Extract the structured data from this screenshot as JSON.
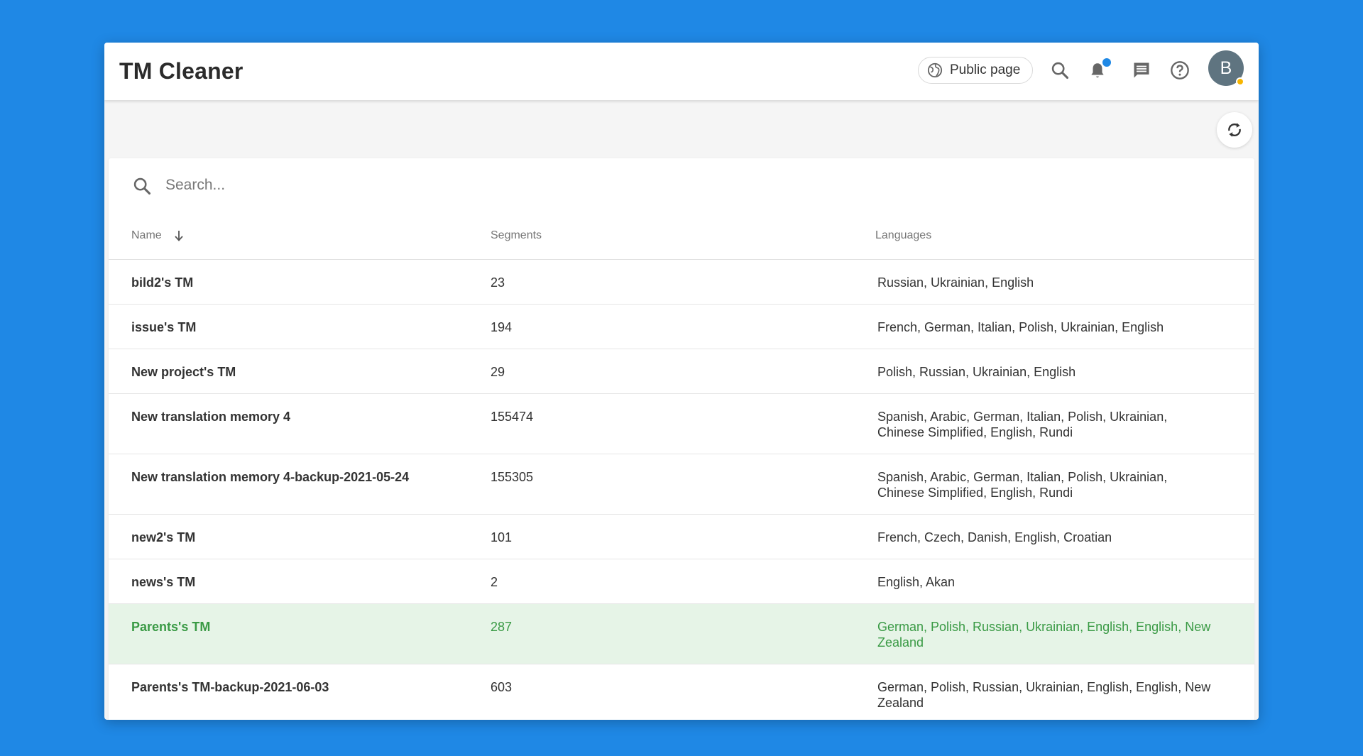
{
  "header": {
    "title": "TM Cleaner",
    "public_page_label": "Public page",
    "avatar_letter": "B"
  },
  "search": {
    "placeholder": "Search..."
  },
  "table": {
    "columns": [
      "Name",
      "Segments",
      "Languages"
    ],
    "rows": [
      {
        "name": "bild2's TM",
        "segments": "23",
        "languages": "Russian, Ukrainian, English"
      },
      {
        "name": "issue's TM",
        "segments": "194",
        "languages": "French, German, Italian, Polish, Ukrainian, English"
      },
      {
        "name": "New project's TM",
        "segments": "29",
        "languages": "Polish, Russian, Ukrainian, English"
      },
      {
        "name": "New translation memory 4",
        "segments": "155474",
        "languages": "Spanish, Arabic, German, Italian, Polish, Ukrainian, Chinese Simplified, English, Rundi"
      },
      {
        "name": "New translation memory 4-backup-2021-05-24",
        "segments": "155305",
        "languages": "Spanish, Arabic, German, Italian, Polish, Ukrainian, Chinese Simplified, English, Rundi"
      },
      {
        "name": "new2's TM",
        "segments": "101",
        "languages": "French, Czech, Danish, English, Croatian"
      },
      {
        "name": "news's TM",
        "segments": "2",
        "languages": "English, Akan"
      },
      {
        "name": "Parents's TM",
        "segments": "287",
        "languages": "German, Polish, Russian, Ukrainian, English, English, New Zealand",
        "selected": true
      },
      {
        "name": "Parents's TM-backup-2021-06-03",
        "segments": "603",
        "languages": "German, Polish, Russian, Ukrainian, English, English, New Zealand"
      }
    ]
  },
  "colors": {
    "background": "#1f88e5",
    "selected_row_bg": "#e6f4e7",
    "selected_row_text": "#3a9a45",
    "notification_dot": "#1f88e5",
    "status_dot": "#f7b500"
  }
}
